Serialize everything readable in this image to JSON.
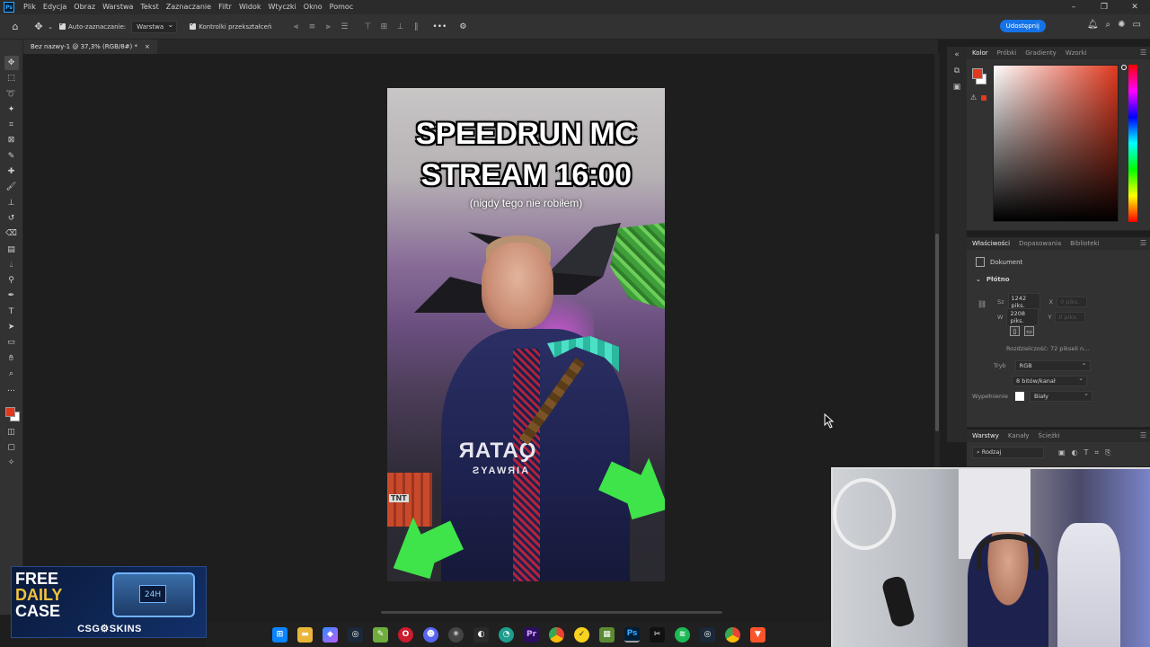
{
  "menubar": {
    "logo": "Ps",
    "items": [
      "Plik",
      "Edycja",
      "Obraz",
      "Warstwa",
      "Tekst",
      "Zaznaczanie",
      "Filtr",
      "Widok",
      "Wtyczki",
      "Okno",
      "Pomoc"
    ]
  },
  "options_bar": {
    "auto_select_label": "Auto-zaznaczanie:",
    "auto_select_target": "Warstwa",
    "transform_controls_label": "Kontrolki przekształceń",
    "share_label": "Udostępnij"
  },
  "document_tab": {
    "title": "Bez nazwy-1 @ 37,3% (RGB/8#) *",
    "close": "×"
  },
  "artboard": {
    "title_line1": "SPEEDRUN MC",
    "title_line2": "STREAM 16:00",
    "subtitle": "(nigdy tego nie robiłem)",
    "shirt_text": "QATAR",
    "shirt_subtext": "AIRWAYS",
    "tnt_label": "TNT"
  },
  "color_panel": {
    "tabs": [
      "Kolor",
      "Próbki",
      "Gradienty",
      "Wzorki"
    ],
    "foreground": "#e0391f",
    "background": "#ffffff"
  },
  "properties_panel": {
    "tabs": [
      "Właściwości",
      "Dopasowania",
      "Biblioteki"
    ],
    "document_label": "Dokument",
    "canvas_section": "Płótno",
    "width_label": "Sz",
    "width_value": "1242 piks.",
    "height_label": "W",
    "height_value": "2208 piks.",
    "x_label": "X",
    "x_placeholder": "0 piks.",
    "y_label": "Y",
    "y_placeholder": "0 piks.",
    "resolution": "Rozdzielczość: 72 pikseli n...",
    "mode_label": "Tryb",
    "mode_value": "RGB",
    "depth_value": "8 bitów/kanał",
    "fill_label": "Wypełnienie",
    "fill_value": "Biały"
  },
  "layers_panel": {
    "tabs": [
      "Warstwy",
      "Kanały",
      "Ścieżki"
    ],
    "filter_label": "Rodzaj"
  },
  "sponsor": {
    "line1": "FREE",
    "line2": "DAILY",
    "line3": "CASE",
    "badge": "24H",
    "brand": "CSG⚙SKINS"
  },
  "taskbar": {
    "icons": [
      "windows-start",
      "file-explorer",
      "copilot",
      "steam",
      "notepad",
      "opera",
      "discord",
      "chatgpt",
      "epic",
      "edge",
      "premiere",
      "chrome",
      "norton",
      "minecraft",
      "photoshop",
      "capcut",
      "spotify",
      "steam-2",
      "chrome-2",
      "brave"
    ]
  }
}
